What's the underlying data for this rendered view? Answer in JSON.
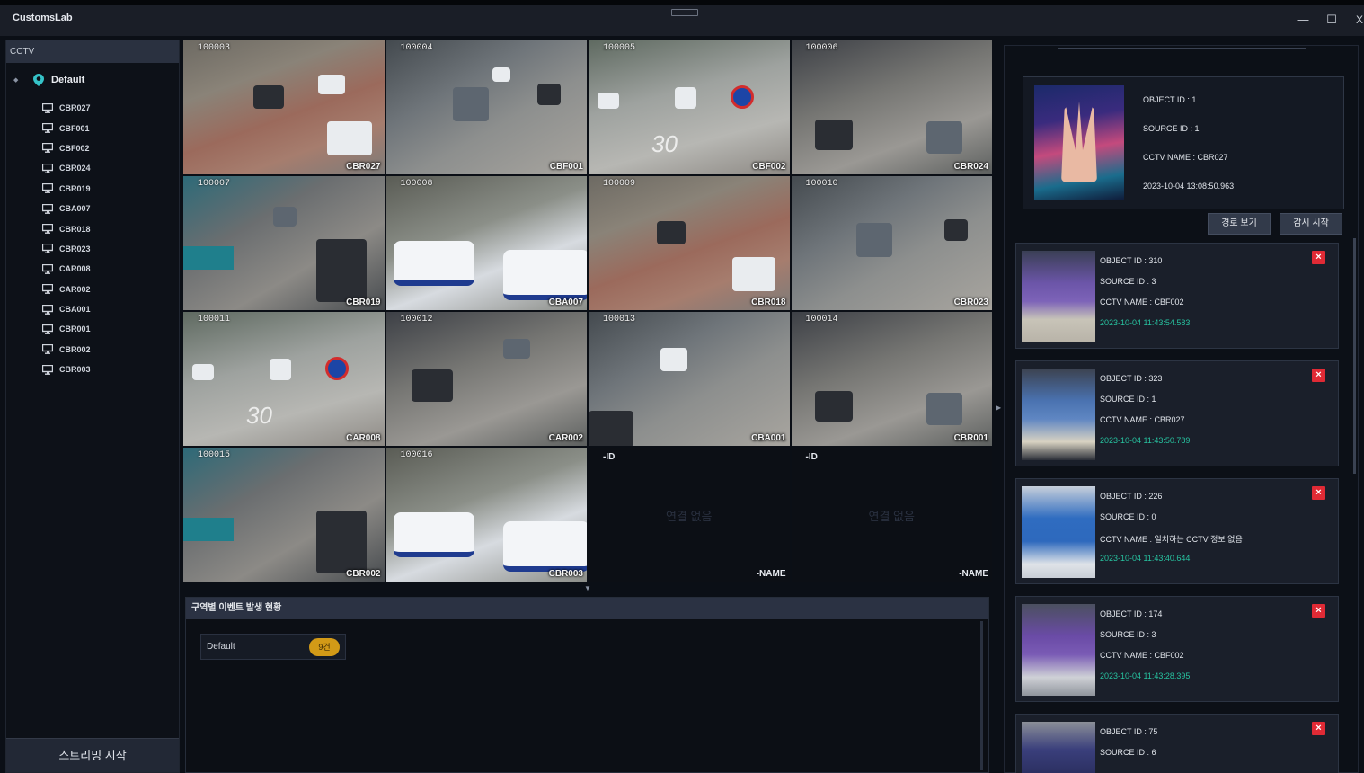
{
  "app": {
    "title": "CustomsLab"
  },
  "window": {
    "minimize": "—",
    "maximize": "☐",
    "close": "X"
  },
  "sidebar": {
    "header": "CCTV",
    "root": "Default",
    "items": [
      "CBR027",
      "CBF001",
      "CBF002",
      "CBR024",
      "CBR019",
      "CBA007",
      "CBR018",
      "CBR023",
      "CAR008",
      "CAR002",
      "CBA001",
      "CBR001",
      "CBR002",
      "CBR003"
    ],
    "stream_button": "스트리밍 시작"
  },
  "grid": {
    "cells": [
      {
        "id": "100003",
        "name": "CBR027"
      },
      {
        "id": "100004",
        "name": "CBF001"
      },
      {
        "id": "100005",
        "name": "CBF002"
      },
      {
        "id": "100006",
        "name": "CBR024"
      },
      {
        "id": "100007",
        "name": "CBR019"
      },
      {
        "id": "100008",
        "name": "CBA007"
      },
      {
        "id": "100009",
        "name": "CBR018"
      },
      {
        "id": "100010",
        "name": "CBR023"
      },
      {
        "id": "100011",
        "name": "CAR008"
      },
      {
        "id": "100012",
        "name": "CAR002"
      },
      {
        "id": "100013",
        "name": "CBA001"
      },
      {
        "id": "100014",
        "name": "CBR001"
      },
      {
        "id": "100015",
        "name": "CBR002"
      },
      {
        "id": "100016",
        "name": "CBR003"
      }
    ],
    "empty_cells": [
      {
        "id_label": "-ID",
        "message": "연결 없음",
        "name_label": "-NAME"
      },
      {
        "id_label": "-ID",
        "message": "연결 없음",
        "name_label": "-NAME"
      }
    ],
    "speed_sign": "30"
  },
  "events": {
    "header": "구역별 이벤트 발생 현황",
    "zones": [
      {
        "name": "Default",
        "count": "9건"
      }
    ]
  },
  "featured": {
    "object_id": "OBJECT ID : 1",
    "source_id": "SOURCE ID : 1",
    "cctv_name": "CCTV NAME : CBR027",
    "timestamp": "2023-10-04 13:08:50.963"
  },
  "buttons": {
    "path_view": "경로 보기",
    "watch_start": "감시 시작"
  },
  "detections": [
    {
      "object_id": "OBJECT ID : 310",
      "source_id": "SOURCE ID : 3",
      "cctv_name": "CCTV NAME : CBF002",
      "timestamp": "2023-10-04 11:43:54.583"
    },
    {
      "object_id": "OBJECT ID : 323",
      "source_id": "SOURCE ID : 1",
      "cctv_name": "CCTV NAME : CBR027",
      "timestamp": "2023-10-04 11:43:50.789"
    },
    {
      "object_id": "OBJECT ID : 226",
      "source_id": "SOURCE ID : 0",
      "cctv_name": "CCTV NAME : 일치하는 CCTV 정보 없음",
      "timestamp": "2023-10-04 11:43:40.644"
    },
    {
      "object_id": "OBJECT ID : 174",
      "source_id": "SOURCE ID : 3",
      "cctv_name": "CCTV NAME : CBF002",
      "timestamp": "2023-10-04 11:43:28.395"
    },
    {
      "object_id": "OBJECT ID : 75",
      "source_id": "SOURCE ID : 6",
      "cctv_name": "",
      "timestamp": ""
    }
  ],
  "delete_label": "×",
  "colors": {
    "timestamp": "#27c3a0",
    "delete": "#e02a35",
    "badge": "#d29a17"
  }
}
